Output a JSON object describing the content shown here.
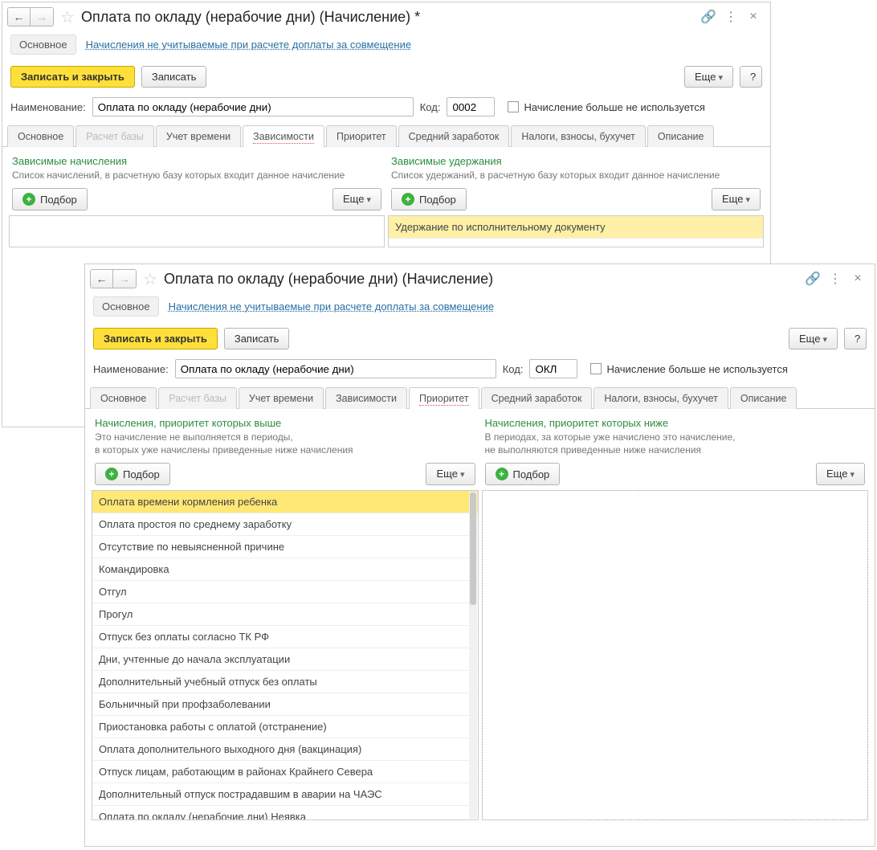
{
  "windows": [
    {
      "title": "Оплата по окладу (нерабочие дни) (Начисление) *",
      "subnav_main": "Основное",
      "subnav_link": "Начисления не учитываемые при расчете доплаты за совмещение",
      "btn_save_close": "Записать и закрыть",
      "btn_save": "Записать",
      "btn_more": "Еще",
      "btn_help": "?",
      "label_name": "Наименование:",
      "value_name": "Оплата по окладу (нерабочие дни)",
      "label_code": "Код:",
      "value_code": "0002",
      "chk_unused": "Начисление больше не используется",
      "tabs": [
        "Основное",
        "Расчет базы",
        "Учет времени",
        "Зависимости",
        "Приоритет",
        "Средний заработок",
        "Налоги, взносы, бухучет",
        "Описание"
      ],
      "active_tab": 3,
      "disabled_tab": 1,
      "left": {
        "title": "Зависимые начисления",
        "desc": "Список начислений, в расчетную базу которых входит данное начисление",
        "btn": "Подбор",
        "more": "Еще",
        "rows": []
      },
      "right": {
        "title": "Зависимые удержания",
        "desc": "Список удержаний, в расчетную базу которых входит данное начисление",
        "btn": "Подбор",
        "more": "Еще",
        "rows": [
          "Удержание по исполнительному документу"
        ]
      }
    },
    {
      "title": "Оплата по окладу (нерабочие дни) (Начисление)",
      "subnav_main": "Основное",
      "subnav_link": "Начисления не учитываемые при расчете доплаты за совмещение",
      "btn_save_close": "Записать и закрыть",
      "btn_save": "Записать",
      "btn_more": "Еще",
      "btn_help": "?",
      "label_name": "Наименование:",
      "value_name": "Оплата по окладу (нерабочие дни)",
      "label_code": "Код:",
      "value_code": "ОКЛ",
      "chk_unused": "Начисление больше не используется",
      "tabs": [
        "Основное",
        "Расчет базы",
        "Учет времени",
        "Зависимости",
        "Приоритет",
        "Средний заработок",
        "Налоги, взносы, бухучет",
        "Описание"
      ],
      "active_tab": 4,
      "disabled_tab": 1,
      "left": {
        "title": "Начисления, приоритет которых выше",
        "desc": "Это начисление не выполняется в периоды,\nв которых уже начислены приведенные ниже начисления",
        "btn": "Подбор",
        "more": "Еще",
        "rows": [
          "Оплата времени кормления ребенка",
          "Оплата простоя по среднему заработку",
          "Отсутствие по невыясненной причине",
          "Командировка",
          "Отгул",
          "Прогул",
          "Отпуск без оплаты согласно ТК РФ",
          "Дни, учтенные до начала эксплуатации",
          "Дополнительный учебный отпуск без оплаты",
          "Больничный при профзаболевании",
          "Приостановка работы с оплатой (отстранение)",
          "Оплата дополнительного выходного дня (вакцинация)",
          "Отпуск лицам, работающим в районах Крайнего Севера",
          "Дополнительный отпуск пострадавшим в аварии на ЧАЭС",
          "Оплата по окладу (нерабочие дни) Неявка"
        ]
      },
      "right": {
        "title": "Начисления, приоритет которых ниже",
        "desc": "В периодах, за которые уже начислено это начисление,\nне выполняются приведенные ниже начисления",
        "btn": "Подбор",
        "more": "Еще",
        "rows": []
      }
    }
  ]
}
